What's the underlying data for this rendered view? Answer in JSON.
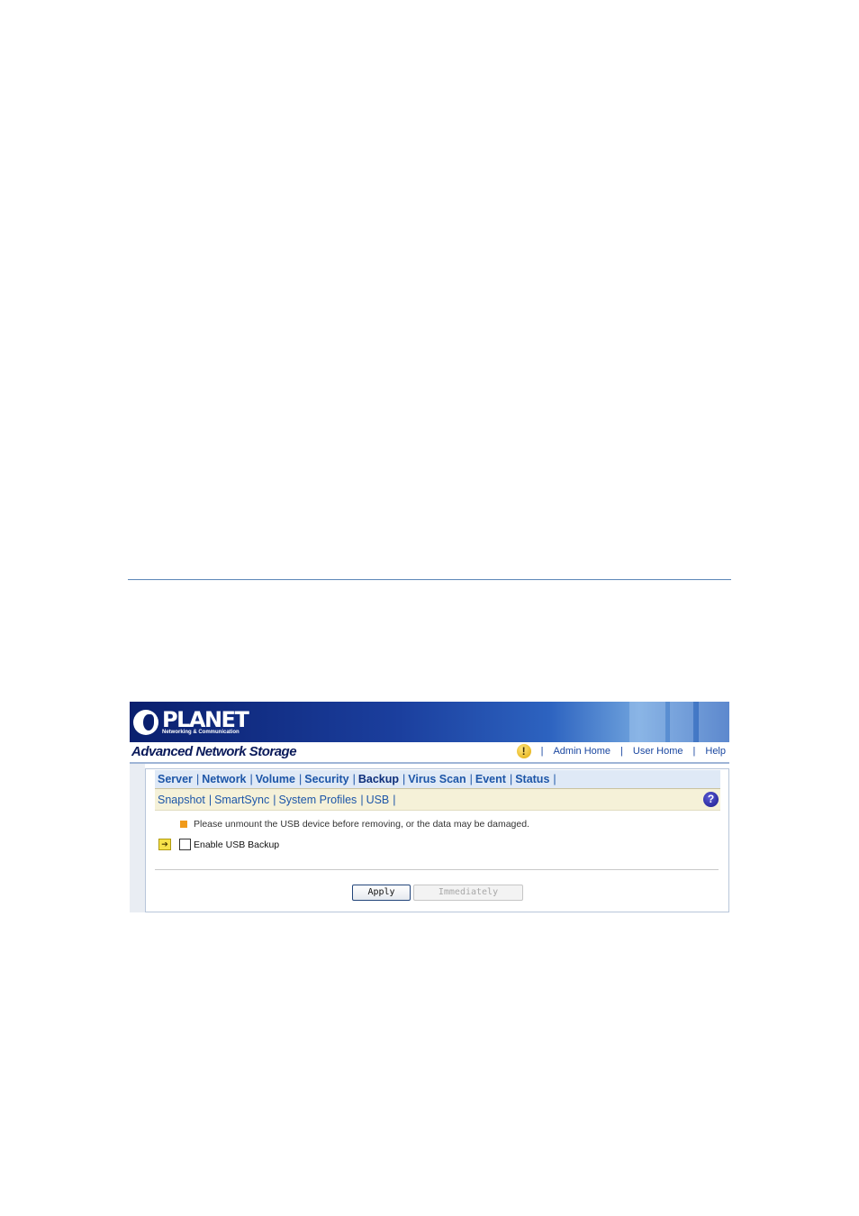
{
  "brand": {
    "logo_name": "PLANET",
    "logo_subtitle": "Networking & Communication",
    "app_title": "Advanced Network Storage"
  },
  "top_links": [
    "Admin Home",
    "User Home",
    "Help"
  ],
  "main_menu": [
    {
      "label": "Server",
      "active": false
    },
    {
      "label": "Network",
      "active": false
    },
    {
      "label": "Volume",
      "active": false
    },
    {
      "label": "Security",
      "active": false
    },
    {
      "label": "Backup",
      "active": true
    },
    {
      "label": "Virus Scan",
      "active": false
    },
    {
      "label": "Event",
      "active": false
    },
    {
      "label": "Status",
      "active": false
    }
  ],
  "sub_menu": [
    "Snapshot",
    "SmartSync",
    "System Profiles",
    "USB"
  ],
  "notice": "Please unmount the USB device before removing, or the data may be damaged.",
  "option": {
    "label": "Enable USB Backup",
    "checked": false
  },
  "buttons": {
    "apply": "Apply",
    "immediately": "Immediately"
  },
  "icons": {
    "warning": "warning-icon",
    "help": "help-icon",
    "arrow": "arrow-icon"
  },
  "colors": {
    "banner": "#0a1f6e",
    "link": "#1d56a8",
    "notice_marker": "#f09a1a",
    "submenu_bg": "#f5f1d8"
  }
}
